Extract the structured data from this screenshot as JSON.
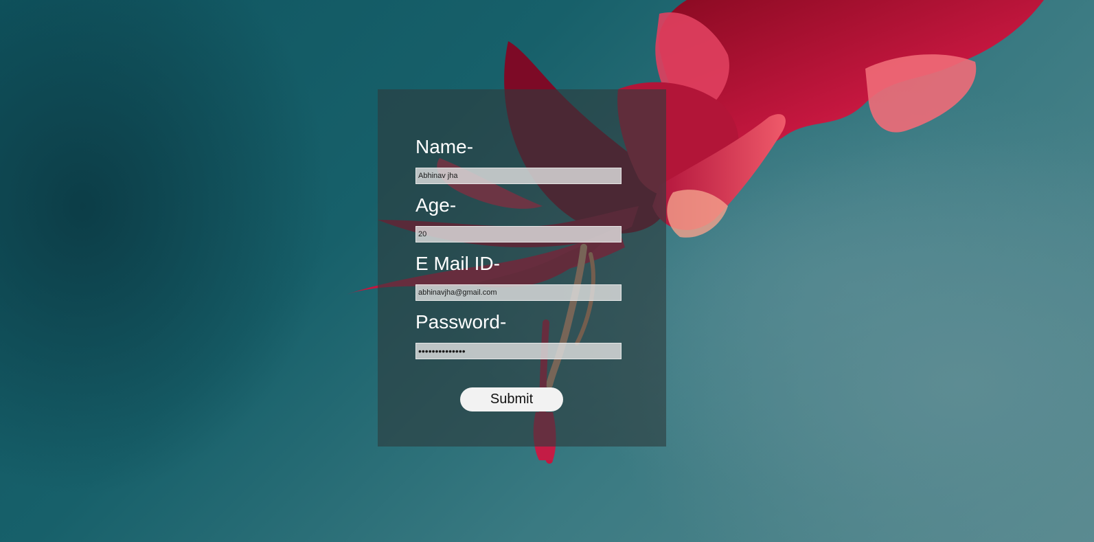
{
  "form": {
    "name_label": "Name-",
    "name_value": "Abhinav jha",
    "age_label": "Age-",
    "age_value": "20",
    "email_label": "E Mail ID-",
    "email_value": "abhinavjha@gmail.com",
    "password_label": "Password-",
    "password_value": "abhinavjha1234",
    "submit_label": "Submit"
  },
  "colors": {
    "background": "#17606a",
    "panel": "#2d3c3e",
    "flower": "#d81b4a",
    "input": "#dedede",
    "button": "#f2f2f2"
  }
}
